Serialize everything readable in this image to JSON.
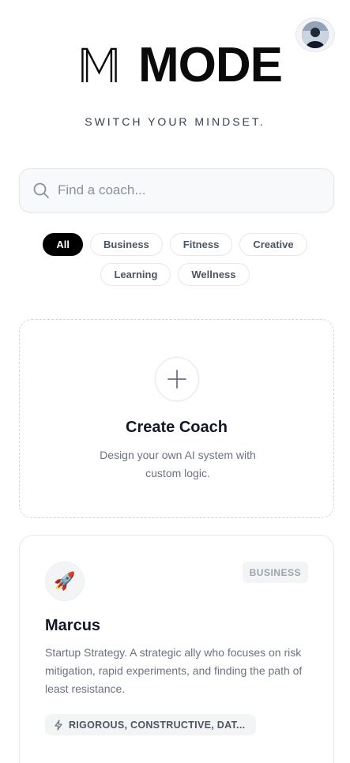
{
  "brand": {
    "name": "MODE",
    "tagline": "SWITCH YOUR MINDSET."
  },
  "user": {
    "avatar_icon": "user-photo-avatar"
  },
  "search": {
    "placeholder": "Find a coach...",
    "value": "",
    "icon": "search-icon"
  },
  "filters": [
    {
      "label": "All",
      "active": true
    },
    {
      "label": "Business",
      "active": false
    },
    {
      "label": "Fitness",
      "active": false
    },
    {
      "label": "Creative",
      "active": false
    },
    {
      "label": "Learning",
      "active": false
    },
    {
      "label": "Wellness",
      "active": false
    }
  ],
  "create_card": {
    "icon": "plus-icon",
    "title": "Create Coach",
    "description": "Design your own AI system with custom logic."
  },
  "coaches": [
    {
      "emoji": "🚀",
      "category": "BUSINESS",
      "name": "Marcus",
      "description": "Startup Strategy. A strategic ally who focuses on risk mitigation, rapid experiments, and finding the path of least resistance.",
      "traits_icon": "lightning-icon",
      "traits": "RIGOROUS, CONSTRUCTIVE, DAT..."
    }
  ],
  "colors": {
    "accent": "#000000",
    "muted_text": "#6b7280",
    "border": "#e5e7eb"
  }
}
